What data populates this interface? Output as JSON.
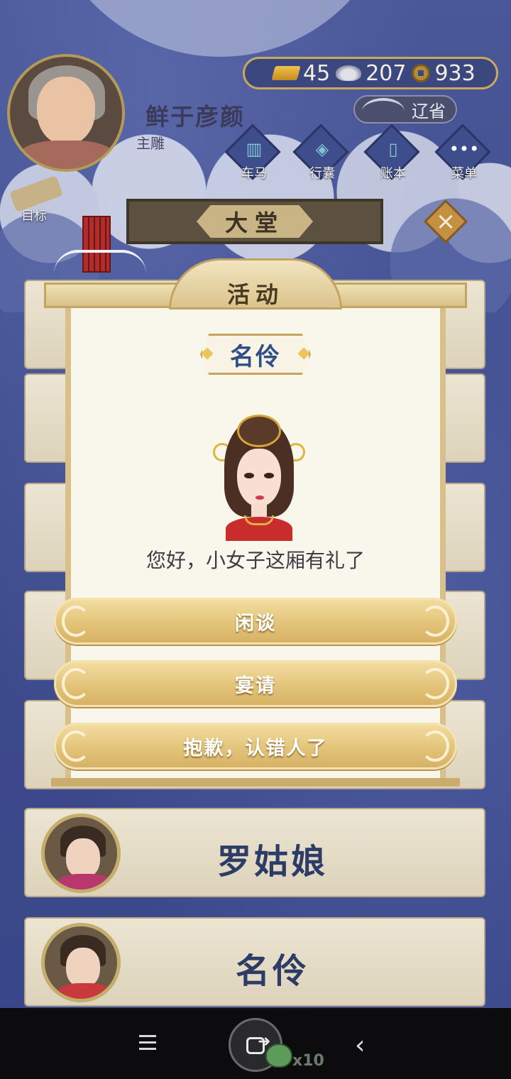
{
  "player": {
    "name": "鲜于彦颜",
    "title": "主雕"
  },
  "currency": {
    "gold": "45",
    "silver": "207",
    "coins": "933"
  },
  "location": {
    "province": "辽省"
  },
  "menu": [
    {
      "label": "车马",
      "icon": "carriage-icon"
    },
    {
      "label": "行囊",
      "icon": "bag-icon"
    },
    {
      "label": "账本",
      "icon": "ledger-icon"
    },
    {
      "label": "菜单",
      "icon": "more-icon"
    }
  ],
  "goal": {
    "label": "目标"
  },
  "hall": {
    "title": "大堂"
  },
  "modal": {
    "title": "活动",
    "npc_name": "名伶",
    "greeting": "您好，小女子这厢有礼了",
    "options": [
      "闲谈",
      "宴请",
      "抱歉，认错人了"
    ]
  },
  "list": [
    {
      "name": "罗姑娘"
    },
    {
      "name": "名伶"
    }
  ],
  "system_nav": {
    "count": "x10"
  }
}
